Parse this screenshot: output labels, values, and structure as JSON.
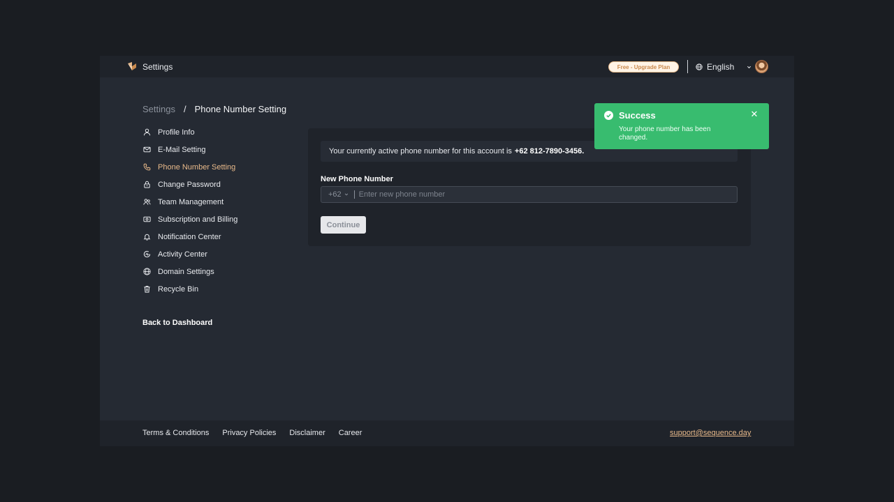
{
  "header": {
    "title": "Settings",
    "upgrade_label": "Free - Upgrade Plan",
    "language": "English"
  },
  "breadcrumb": {
    "root": "Settings",
    "separator": "/",
    "current": "Phone Number Setting"
  },
  "sidebar": {
    "items": [
      {
        "label": "Profile Info",
        "icon": "user-icon"
      },
      {
        "label": "E-Mail Setting",
        "icon": "mail-icon"
      },
      {
        "label": "Phone Number Setting",
        "icon": "phone-icon",
        "active": true
      },
      {
        "label": "Change Password",
        "icon": "lock-icon"
      },
      {
        "label": "Team Management",
        "icon": "team-icon"
      },
      {
        "label": "Subscription and Billing",
        "icon": "billing-icon"
      },
      {
        "label": "Notification Center",
        "icon": "bell-icon"
      },
      {
        "label": "Activity Center",
        "icon": "activity-icon"
      },
      {
        "label": "Domain Settings",
        "icon": "globe-icon"
      },
      {
        "label": "Recycle Bin",
        "icon": "trash-icon"
      }
    ],
    "back_label": "Back to Dashboard"
  },
  "main": {
    "info_text": "Your currently active phone number for this account is",
    "active_number": "+62 812-7890-3456.",
    "field_label": "New Phone Number",
    "country_code": "+62",
    "phone_placeholder": "Enter new phone number",
    "phone_value": "",
    "continue_label": "Continue"
  },
  "footer": {
    "links": [
      "Terms & Conditions",
      "Privacy Policies",
      "Disclaimer",
      "Career"
    ],
    "support_email": "support@sequence.day"
  },
  "toast": {
    "title": "Success",
    "message": "Your phone number has been changed."
  },
  "colors": {
    "accent": "#e8b98a",
    "success": "#38bc6f",
    "background": "#252a33"
  }
}
